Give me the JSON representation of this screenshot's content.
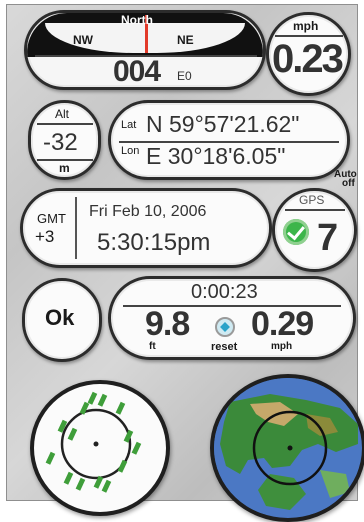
{
  "compass": {
    "north_label": "North",
    "nw_label": "NW",
    "ne_label": "NE",
    "heading": "004",
    "heading_suffix": "E0"
  },
  "speed": {
    "unit": "mph",
    "value": "0.23"
  },
  "altitude": {
    "label": "Alt",
    "value": "-32",
    "unit": "m"
  },
  "position": {
    "lat_label": "Lat",
    "lat_value": "N 59°57'21.62\"",
    "lon_label": "Lon",
    "lon_value": "E 30°18'6.05\""
  },
  "auto_off": {
    "line1": "Auto",
    "line2": "off"
  },
  "datetime": {
    "tz_label": "GMT",
    "tz_offset": "+3",
    "date": "Fri Feb 10, 2006",
    "time": "5:30:15pm"
  },
  "gps": {
    "label": "GPS",
    "satellites": "7",
    "status_color": "#3cb54a"
  },
  "ok_button": {
    "label": "Ok"
  },
  "trip": {
    "elapsed": "0:00:23",
    "distance": "9.8",
    "distance_unit": "ft",
    "reset_label": "reset",
    "avg_speed": "0.29",
    "avg_speed_unit": "mph"
  },
  "colors": {
    "needle": "#e23a2a",
    "sat_green": "#3f9e3a",
    "ocean": "#4b78c4",
    "land": "#3b8a3a"
  }
}
